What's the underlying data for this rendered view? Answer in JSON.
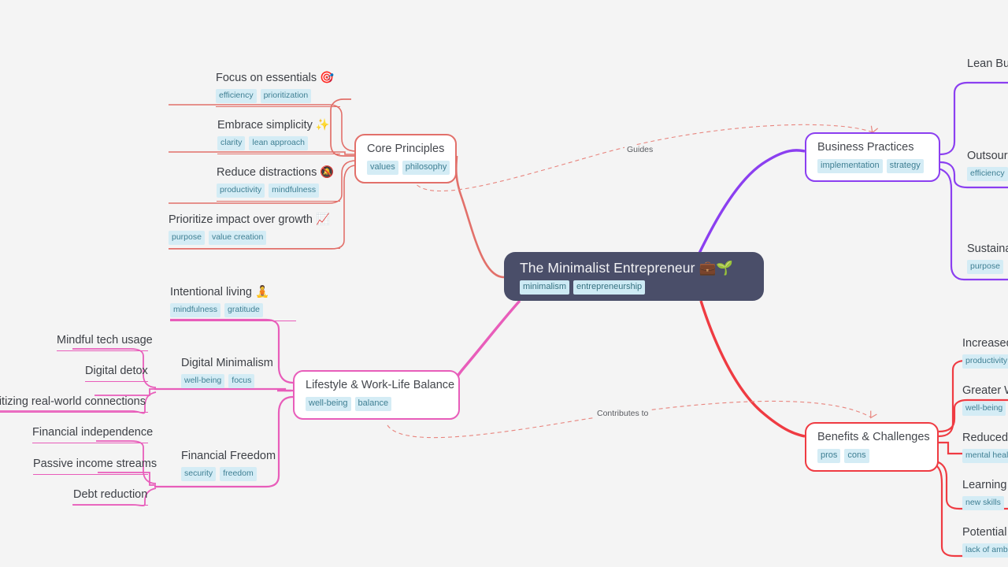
{
  "canvas": {
    "background": "#f4f4f4"
  },
  "central": {
    "title": "The Minimalist Entrepreneur 💼🌱",
    "color": "#4a4e69",
    "tags": [
      "minimalism",
      "entrepreneurship"
    ]
  },
  "cross_links": [
    {
      "label": "Guides",
      "from": "Core Principles",
      "to": "Business Practices",
      "color": "#e8857e"
    },
    {
      "label": "Contributes to",
      "from": "Lifestyle & Work-Life Balance",
      "to": "Benefits & Challenges",
      "color": "#e8857e"
    }
  ],
  "branches": [
    {
      "id": "core-principles",
      "title": "Core Principles",
      "color": "#e2706a",
      "tags": [
        "values",
        "philosophy"
      ],
      "children": [
        {
          "title": "Focus on essentials 🎯",
          "tags": [
            "efficiency",
            "prioritization"
          ]
        },
        {
          "title": "Embrace simplicity ✨",
          "tags": [
            "clarity",
            "lean approach"
          ]
        },
        {
          "title": "Reduce distractions 🔕",
          "tags": [
            "productivity",
            "mindfulness"
          ]
        },
        {
          "title": "Prioritize impact over growth 📈",
          "tags": [
            "purpose",
            "value creation"
          ]
        }
      ]
    },
    {
      "id": "business-practices",
      "title": "Business Practices",
      "color": "#8b3ff0",
      "tags": [
        "implementation",
        "strategy"
      ],
      "children": [
        {
          "title": "Lean Bus",
          "tags": []
        },
        {
          "title": "Outsourc",
          "tags": [
            "efficiency"
          ]
        },
        {
          "title": "Sustaina",
          "tags": [
            "purpose"
          ]
        }
      ]
    },
    {
      "id": "lifestyle-work-life-balance",
      "title": "Lifestyle & Work-Life Balance",
      "color": "#e85dba",
      "tags": [
        "well-being",
        "balance"
      ],
      "children": [
        {
          "title": "Intentional living 🧘",
          "tags": [
            "mindfulness",
            "gratitude"
          ],
          "children": []
        },
        {
          "title": "Digital Minimalism",
          "tags": [
            "well-being",
            "focus"
          ],
          "children": [
            {
              "title": "Mindful tech usage"
            },
            {
              "title": "Digital detox"
            },
            {
              "title": "ritizing real-world connections"
            }
          ]
        },
        {
          "title": "Financial Freedom",
          "tags": [
            "security",
            "freedom"
          ],
          "children": [
            {
              "title": "Financial independence"
            },
            {
              "title": "Passive income streams"
            },
            {
              "title": "Debt reduction"
            }
          ]
        }
      ]
    },
    {
      "id": "benefits-challenges",
      "title": "Benefits & Challenges",
      "color": "#ef3b42",
      "tags": [
        "pros",
        "cons"
      ],
      "children": [
        {
          "title": "Increased",
          "tags": [
            "productivity"
          ]
        },
        {
          "title": "Greater W",
          "tags": [
            "well-being"
          ]
        },
        {
          "title": "Reduced ",
          "tags": [
            "mental heal"
          ]
        },
        {
          "title": "Learning ",
          "tags": [
            "new skills"
          ]
        },
        {
          "title": "Potential ",
          "tags": [
            "lack of amb"
          ]
        }
      ]
    }
  ]
}
